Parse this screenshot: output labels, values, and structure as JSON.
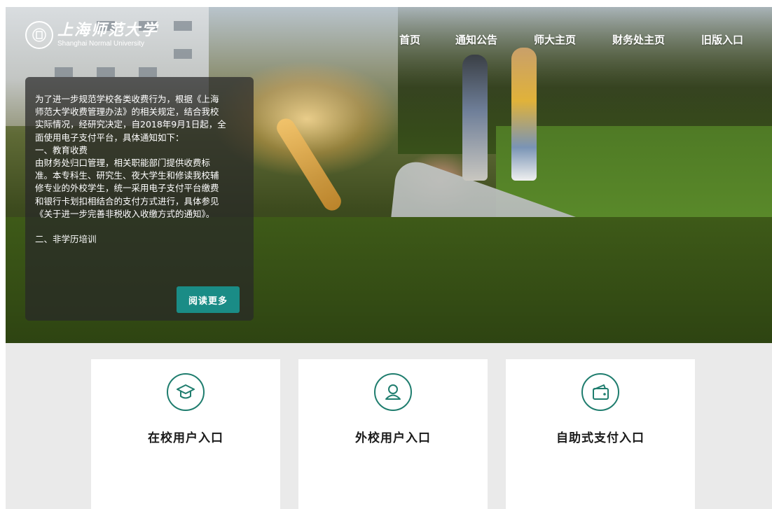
{
  "header": {
    "logo": {
      "name_cn": "上海师范大学",
      "name_en": "Shanghai Normal University"
    },
    "nav": [
      {
        "label": "首页"
      },
      {
        "label": "通知公告"
      },
      {
        "label": "师大主页"
      },
      {
        "label": "财务处主页"
      },
      {
        "label": "旧版入口"
      }
    ]
  },
  "notice": {
    "lines": [
      "为了进一步规范学校各类收费行为，根据《上海",
      "师范大学收费管理办法》的相关规定，结合我校",
      "实际情况，经研究决定，自2018年9月1日起，全",
      "面使用电子支付平台，具体通知如下：",
      "一、教育收费",
      "由财务处归口管理，相关职能部门提供收费标",
      "准。本专科生、研究生、夜大学生和修读我校辅",
      "修专业的外校学生，统一采用电子支付平台缴费",
      "和银行卡划扣相结合的支付方式进行，具体参见",
      "《关于进一步完善非税收入收缴方式的通知》。"
    ],
    "section2": "二、非学历培训",
    "read_more": "阅读更多"
  },
  "entries": [
    {
      "label": "在校用户入口",
      "icon": "graduation-cap-icon"
    },
    {
      "label": "外校用户入口",
      "icon": "user-icon"
    },
    {
      "label": "自助式支付入口",
      "icon": "wallet-icon"
    }
  ],
  "colors": {
    "accent": "#1a8c86",
    "icon_stroke": "#1f7d6e",
    "lower_background": "#eaeaea"
  }
}
